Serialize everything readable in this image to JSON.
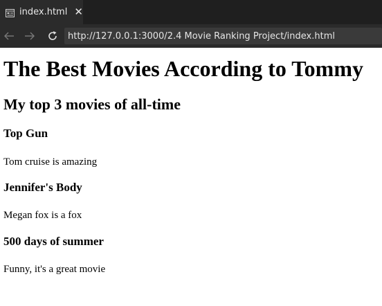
{
  "browser": {
    "tab": {
      "title": "index.html",
      "icon": "preview-icon",
      "close_glyph": "✕"
    },
    "nav": {
      "back_icon": "arrow-left-icon",
      "forward_icon": "arrow-right-icon",
      "reload_icon": "reload-icon"
    },
    "url": "http://127.0.0.1:3000/2.4 Movie Ranking Project/index.html"
  },
  "page": {
    "title": "The Best Movies According to Tommy",
    "subtitle": "My top 3 movies of all-time",
    "movies": [
      {
        "name": "Top Gun",
        "comment": "Tom cruise is amazing"
      },
      {
        "name": "Jennifer's Body",
        "comment": "Megan fox is a fox"
      },
      {
        "name": "500 days of summer",
        "comment": "Funny, it's a great movie"
      }
    ]
  },
  "colors": {
    "tab_strip": "#1f1f1f",
    "toolbar": "#2b2b2b",
    "url_box": "#3a3a3a",
    "chrome_text": "#e6e6e6",
    "page_bg": "#ffffff"
  }
}
